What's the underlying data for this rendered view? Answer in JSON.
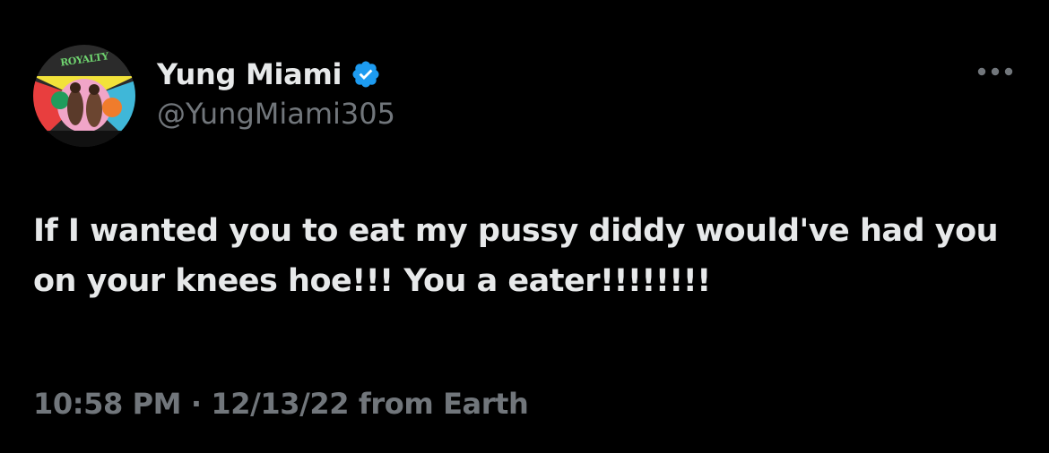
{
  "author": {
    "display_name": "Yung Miami",
    "handle": "@YungMiami305",
    "verified": true,
    "verified_color": "#1d9bf0"
  },
  "avatar": {
    "logo_text": "ROYALTY"
  },
  "tweet": {
    "text": "If I wanted you to eat my pussy diddy would've had you on your knees hoe!!! You a eater!!!!!!!!",
    "time": "10:58 PM",
    "separator": "·",
    "date": "12/13/22",
    "source": "from Earth"
  },
  "icons": {
    "more": "more-horizontal-icon",
    "verified": "verified-badge-icon"
  },
  "colors": {
    "background": "#000000",
    "primary_text": "#e7e9ea",
    "secondary_text": "#71767b"
  }
}
